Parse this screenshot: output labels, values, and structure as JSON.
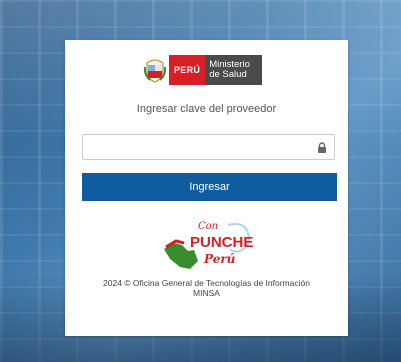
{
  "logo": {
    "country": "PERÚ",
    "ministry_line1": "Ministerio",
    "ministry_line2": "de Salud"
  },
  "login": {
    "subtitle": "Ingresar clave del proveedor",
    "password_placeholder": "",
    "submit_label": "Ingresar"
  },
  "campaign": {
    "line1": "Con",
    "line2": "PUNCHE",
    "line3": "Perú"
  },
  "footer": {
    "line1": "2024 © Oficina General de Tecnologías de Información",
    "line2": "MINSA"
  },
  "colors": {
    "primary_button": "#0f5da0",
    "brand_red": "#d91f26",
    "ministry_gray": "#4a4a4a"
  }
}
